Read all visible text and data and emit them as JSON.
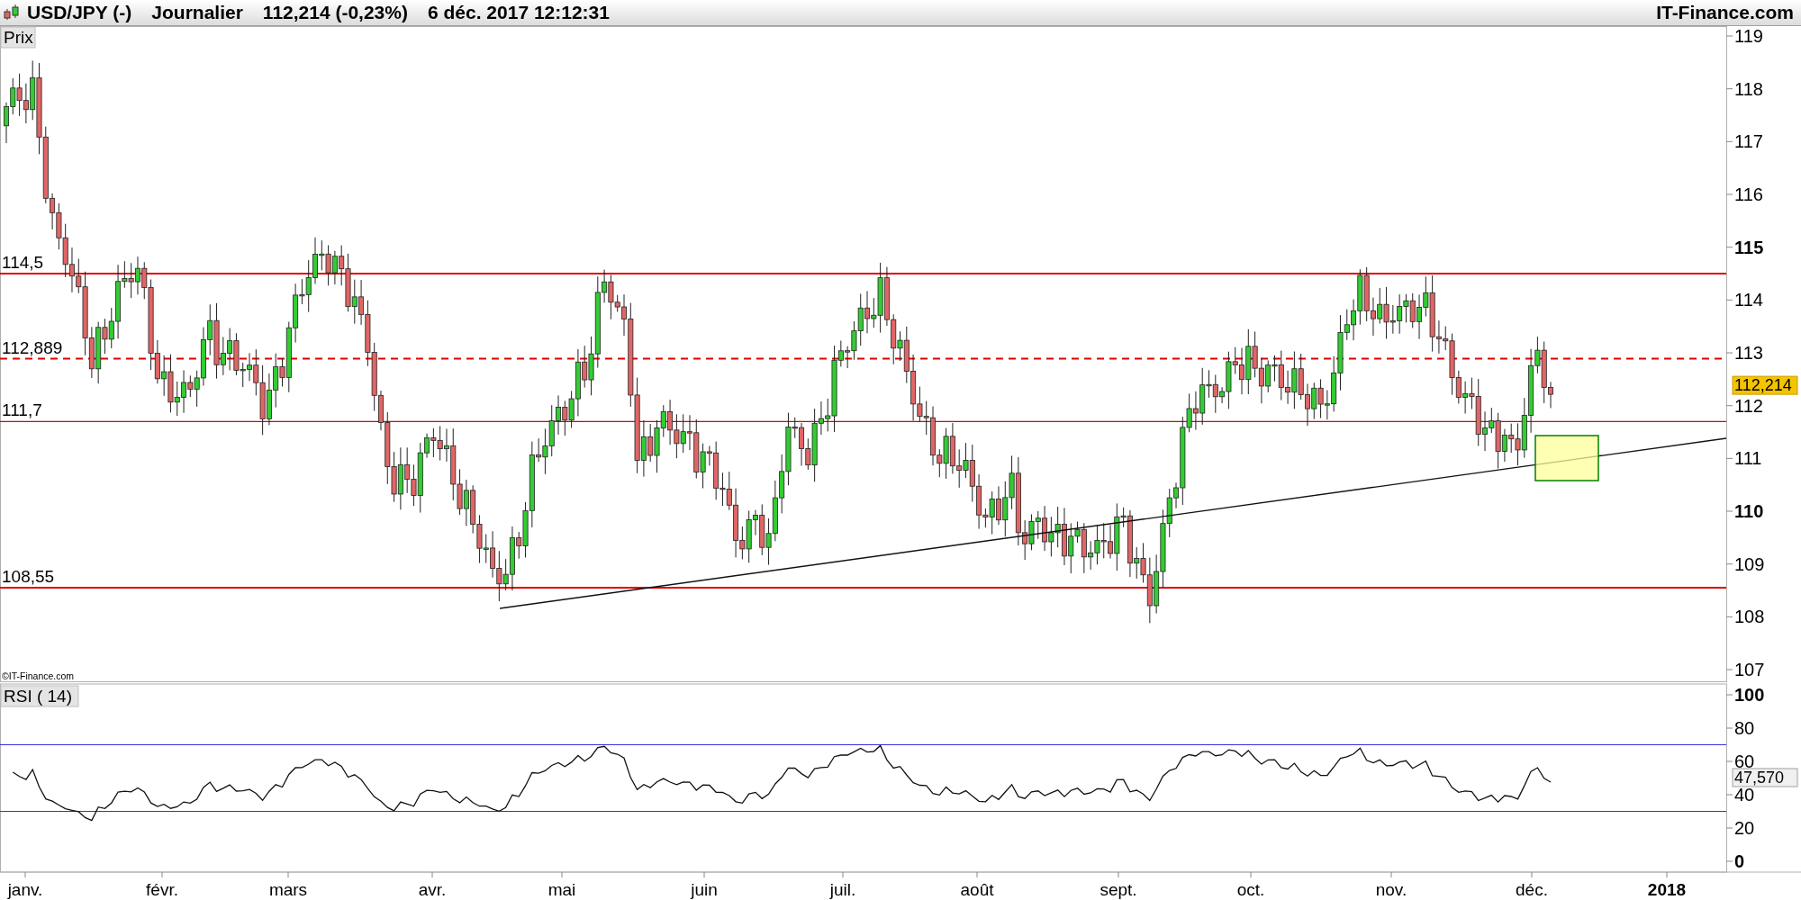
{
  "header": {
    "symbol": "USD/JPY (-)",
    "period": "Journalier",
    "quote": "112,214 (-0,23%)",
    "timestamp": "6 déc. 2017 12:12:31",
    "brand": "IT-Finance.com"
  },
  "price_panel": {
    "label": "Prix",
    "levels": [
      {
        "label": "114,5",
        "kind": "thick"
      },
      {
        "label": "112,889",
        "kind": "dashed"
      },
      {
        "label": "111,7",
        "kind": "thin"
      },
      {
        "label": "108,55",
        "kind": "thick"
      }
    ],
    "y_ticks": [
      {
        "label": "119",
        "bold": false
      },
      {
        "label": "118",
        "bold": false
      },
      {
        "label": "117",
        "bold": false
      },
      {
        "label": "116",
        "bold": false
      },
      {
        "label": "115",
        "bold": true
      },
      {
        "label": "114",
        "bold": false
      },
      {
        "label": "113",
        "bold": false
      },
      {
        "label": "112",
        "bold": false
      },
      {
        "label": "111",
        "bold": false
      },
      {
        "label": "110",
        "bold": true
      },
      {
        "label": "109",
        "bold": false
      },
      {
        "label": "108",
        "bold": false
      },
      {
        "label": "107",
        "bold": false
      }
    ],
    "last_price": "112,214",
    "copyright": "©IT-Finance.com"
  },
  "rsi_panel": {
    "label": "RSI ( 14)",
    "y_ticks": [
      {
        "label": "100",
        "bold": true
      },
      {
        "label": "80",
        "bold": false
      },
      {
        "label": "60",
        "bold": false
      },
      {
        "label": "40",
        "bold": false
      },
      {
        "label": "20",
        "bold": false
      },
      {
        "label": "0",
        "bold": true
      }
    ],
    "last_value": "47,570"
  },
  "x_axis": {
    "labels": [
      {
        "label": "janv.",
        "bold": false
      },
      {
        "label": "févr.",
        "bold": false
      },
      {
        "label": "mars",
        "bold": false
      },
      {
        "label": "avr.",
        "bold": false
      },
      {
        "label": "mai",
        "bold": false
      },
      {
        "label": "juin",
        "bold": false
      },
      {
        "label": "juil.",
        "bold": false
      },
      {
        "label": "août",
        "bold": false
      },
      {
        "label": "sept.",
        "bold": false
      },
      {
        "label": "oct.",
        "bold": false
      },
      {
        "label": "nov.",
        "bold": false
      },
      {
        "label": "déc.",
        "bold": false
      },
      {
        "label": "2018",
        "bold": true
      }
    ]
  }
}
